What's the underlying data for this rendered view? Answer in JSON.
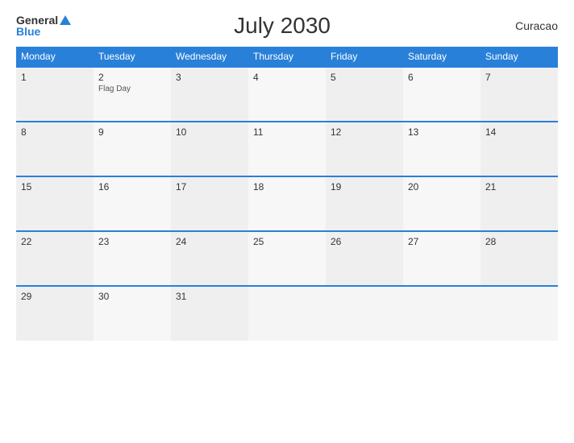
{
  "header": {
    "title": "July 2030",
    "region": "Curacao",
    "logo_general": "General",
    "logo_blue": "Blue"
  },
  "weekdays": [
    "Monday",
    "Tuesday",
    "Wednesday",
    "Thursday",
    "Friday",
    "Saturday",
    "Sunday"
  ],
  "weeks": [
    [
      {
        "day": "1",
        "holiday": ""
      },
      {
        "day": "2",
        "holiday": "Flag Day"
      },
      {
        "day": "3",
        "holiday": ""
      },
      {
        "day": "4",
        "holiday": ""
      },
      {
        "day": "5",
        "holiday": ""
      },
      {
        "day": "6",
        "holiday": ""
      },
      {
        "day": "7",
        "holiday": ""
      }
    ],
    [
      {
        "day": "8",
        "holiday": ""
      },
      {
        "day": "9",
        "holiday": ""
      },
      {
        "day": "10",
        "holiday": ""
      },
      {
        "day": "11",
        "holiday": ""
      },
      {
        "day": "12",
        "holiday": ""
      },
      {
        "day": "13",
        "holiday": ""
      },
      {
        "day": "14",
        "holiday": ""
      }
    ],
    [
      {
        "day": "15",
        "holiday": ""
      },
      {
        "day": "16",
        "holiday": ""
      },
      {
        "day": "17",
        "holiday": ""
      },
      {
        "day": "18",
        "holiday": ""
      },
      {
        "day": "19",
        "holiday": ""
      },
      {
        "day": "20",
        "holiday": ""
      },
      {
        "day": "21",
        "holiday": ""
      }
    ],
    [
      {
        "day": "22",
        "holiday": ""
      },
      {
        "day": "23",
        "holiday": ""
      },
      {
        "day": "24",
        "holiday": ""
      },
      {
        "day": "25",
        "holiday": ""
      },
      {
        "day": "26",
        "holiday": ""
      },
      {
        "day": "27",
        "holiday": ""
      },
      {
        "day": "28",
        "holiday": ""
      }
    ],
    [
      {
        "day": "29",
        "holiday": ""
      },
      {
        "day": "30",
        "holiday": ""
      },
      {
        "day": "31",
        "holiday": ""
      },
      {
        "day": "",
        "holiday": ""
      },
      {
        "day": "",
        "holiday": ""
      },
      {
        "day": "",
        "holiday": ""
      },
      {
        "day": "",
        "holiday": ""
      }
    ]
  ]
}
